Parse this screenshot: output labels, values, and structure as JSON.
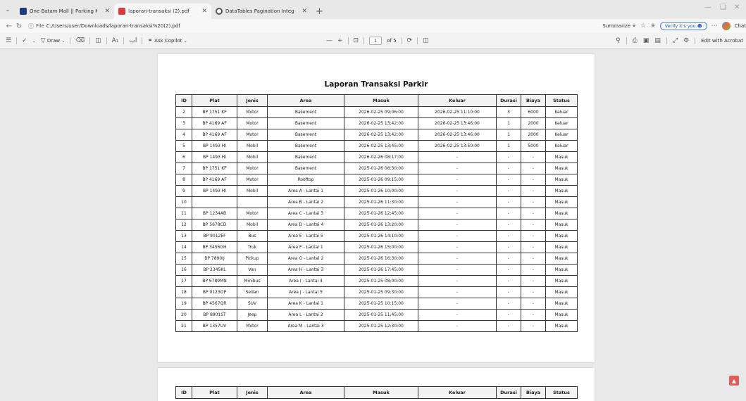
{
  "browser": {
    "tabs": [
      {
        "title": "One Batam Mall || Parking Manag",
        "favicon_color": "#1f3a7a",
        "active": false
      },
      {
        "title": "laporan-transaksi (2).pdf",
        "favicon_color": "#d93a3a",
        "active": true
      },
      {
        "title": "DataTables Pagination Integration",
        "favicon_color": "#555555",
        "active": false
      }
    ],
    "tab_close": "✕",
    "new_tab": "+",
    "address": {
      "prefix": "File",
      "url": "C:/Users/user/Downloads/laporan-transaksi%20(2).pdf"
    },
    "summarize_label": "Summarize",
    "verify_label": "Verify it's you",
    "chat_label": "Chat"
  },
  "pdf_toolbar": {
    "draw_label": "Draw",
    "copilot_label": "Ask Copilot",
    "page_current": "1",
    "page_total": "of 5",
    "edit_label": "Edit with Acrobat"
  },
  "report": {
    "title": "Laporan Transaksi Parkir",
    "columns": [
      "ID",
      "Plat",
      "Jenis",
      "Area",
      "Masuk",
      "Keluar",
      "Durasi",
      "Biaya",
      "Status"
    ],
    "rows": [
      [
        "2",
        "BP 1751 KF",
        "Motor",
        "Basement",
        "2026-02-25 09:06:00",
        "2026-02-25 11:10:00",
        "3",
        "6000",
        "Keluar"
      ],
      [
        "3",
        "BP 4169 AF",
        "Motor",
        "Basement",
        "2026-02-25 13:42:00",
        "2026-02-25 13:46:00",
        "1",
        "2000",
        "Keluar"
      ],
      [
        "4",
        "BP 4169 AF",
        "Motor",
        "Basement",
        "2026-02-25 13:42:00",
        "2026-02-25 13:46:00",
        "1",
        "2000",
        "Keluar"
      ],
      [
        "5",
        "BP 1493 HI",
        "Mobil",
        "Basement",
        "2026-02-25 13:45:00",
        "2026-02-25 13:50:00",
        "1",
        "5000",
        "Keluar"
      ],
      [
        "6",
        "BP 1493 HI",
        "Mobil",
        "Basement",
        "2026-02-26 08:17:00",
        "-",
        "-",
        "-",
        "Masuk"
      ],
      [
        "7",
        "BP 1751 KF",
        "Motor",
        "Basement",
        "2025-01-26 08:30:00",
        "-",
        "-",
        "-",
        "Masuk"
      ],
      [
        "8",
        "BP 4169 AF",
        "Motor",
        "Rooftop",
        "2025-01-26 09:15:00",
        "-",
        "-",
        "-",
        "Masuk"
      ],
      [
        "9",
        "BP 1493 HI",
        "Mobil",
        "Area A - Lantai 1",
        "2025-01-26 10:00:00",
        "-",
        "-",
        "-",
        "Masuk"
      ],
      [
        "10",
        "",
        "",
        "Area B - Lantai 2",
        "2025-01-26 11:30:00",
        "-",
        "-",
        "-",
        "Masuk"
      ],
      [
        "11",
        "BP 1234AB",
        "Motor",
        "Area C - Lantai 3",
        "2025-01-26 12:45:00",
        "-",
        "-",
        "-",
        "Masuk"
      ],
      [
        "12",
        "BP 5678CD",
        "Mobil",
        "Area D - Lantai 4",
        "2025-01-26 13:20:00",
        "-",
        "-",
        "-",
        "Masuk"
      ],
      [
        "13",
        "BP 9012EF",
        "Bus",
        "Area E - Lantai 5",
        "2025-01-26 14:10:00",
        "-",
        "-",
        "-",
        "Masuk"
      ],
      [
        "14",
        "BP 3456GH",
        "Truk",
        "Area F - Lantai 1",
        "2025-01-26 15:00:00",
        "-",
        "-",
        "-",
        "Masuk"
      ],
      [
        "15",
        "BP 7890IJ",
        "Pickup",
        "Area G - Lantai 2",
        "2025-01-26 16:30:00",
        "-",
        "-",
        "-",
        "Masuk"
      ],
      [
        "16",
        "BP 2345KL",
        "Van",
        "Area H - Lantai 3",
        "2025-01-26 17:45:00",
        "-",
        "-",
        "-",
        "Masuk"
      ],
      [
        "17",
        "BP 6789MN",
        "Minibus",
        "Area I - Lantai 4",
        "2025-01-25 08:00:00",
        "-",
        "-",
        "-",
        "Masuk"
      ],
      [
        "18",
        "BP 0123OP",
        "Sedan",
        "Area J - Lantai 5",
        "2025-01-25 09:30:00",
        "-",
        "-",
        "-",
        "Masuk"
      ],
      [
        "19",
        "BP 4567QR",
        "SUV",
        "Area K - Lantai 1",
        "2025-01-25 10:15:00",
        "-",
        "-",
        "-",
        "Masuk"
      ],
      [
        "20",
        "BP 8901ST",
        "Jeep",
        "Area L - Lantai 2",
        "2025-01-25 11:45:00",
        "-",
        "-",
        "-",
        "Masuk"
      ],
      [
        "21",
        "BP 1357UV",
        "Motor",
        "Area M - Lantai 3",
        "2025-01-25 12:30:00",
        "-",
        "-",
        "-",
        "Masuk"
      ]
    ]
  }
}
